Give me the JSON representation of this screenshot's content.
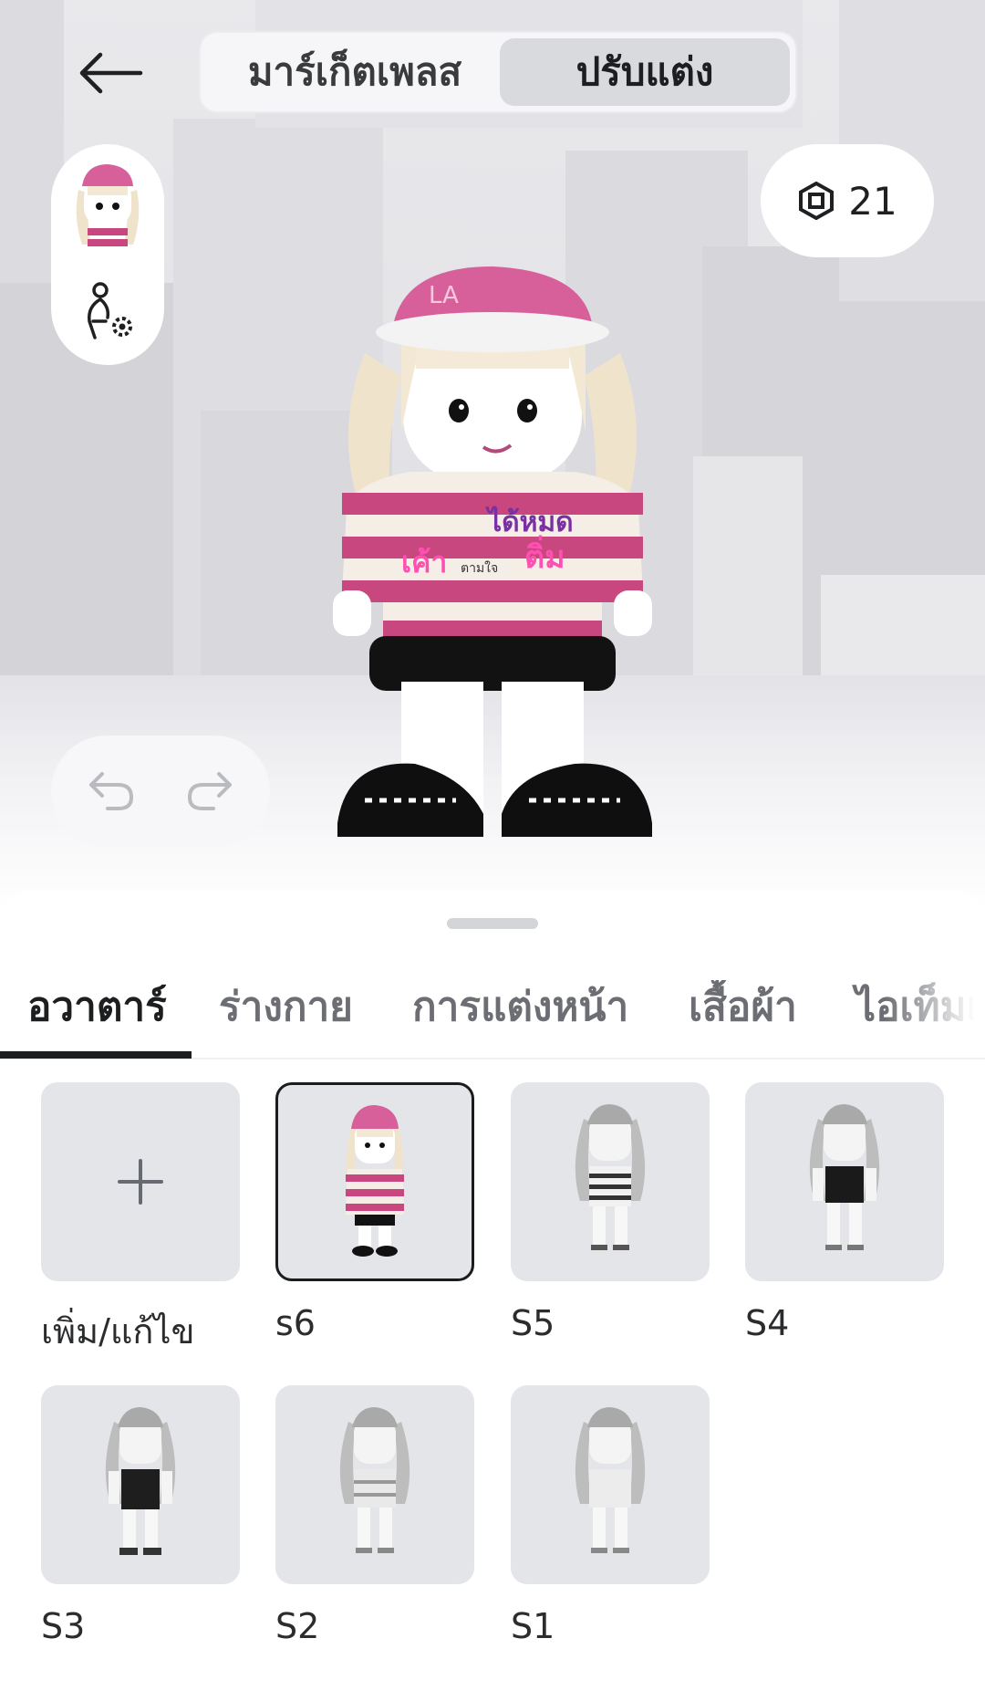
{
  "header": {
    "back_icon": "arrow-left-icon",
    "tabs": [
      {
        "label": "มาร์เก็ตเพลส",
        "active": false
      },
      {
        "label": "ปรับแต่ง",
        "active": true
      }
    ]
  },
  "currency": {
    "icon": "robux-icon",
    "amount": "21"
  },
  "avatar_shirt_text": {
    "line1": "ได้หมด",
    "line2": "เค้า",
    "line3": "ตามใจ",
    "line4": "ติ่ม"
  },
  "categories": [
    {
      "label": "อวาตาร์",
      "active": true
    },
    {
      "label": "ร่างกาย",
      "active": false
    },
    {
      "label": "การแต่งหน้า",
      "active": false
    },
    {
      "label": "เสื้อผ้า",
      "active": false
    },
    {
      "label": "ไอเท็มแ",
      "active": false
    }
  ],
  "outfits": [
    {
      "label": "เพิ่ม/แก้ไข",
      "type": "add",
      "icon": "plus-icon"
    },
    {
      "label": "s6",
      "type": "outfit",
      "selected": true
    },
    {
      "label": "S5",
      "type": "outfit",
      "selected": false
    },
    {
      "label": "S4",
      "type": "outfit",
      "selected": false
    },
    {
      "label": "S3",
      "type": "outfit",
      "selected": false
    },
    {
      "label": "S2",
      "type": "outfit",
      "selected": false
    },
    {
      "label": "S1",
      "type": "outfit",
      "selected": false
    }
  ],
  "colors": {
    "accent": "#1d1e20",
    "tile_bg": "#e4e5e9",
    "shirt_pink": "#c8477f",
    "cap_pink": "#d7609b"
  }
}
